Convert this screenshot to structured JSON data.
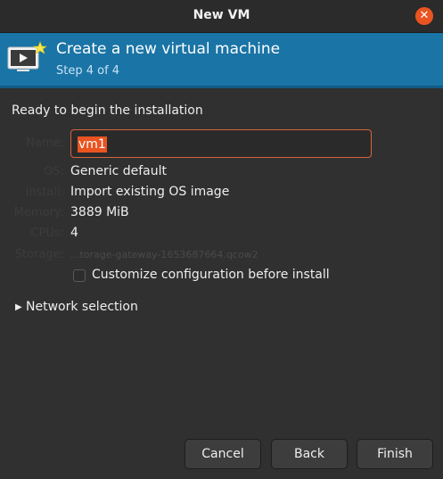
{
  "window": {
    "title": "New VM",
    "close_icon": "close-icon"
  },
  "header": {
    "title": "Create a new virtual machine",
    "step": "Step 4 of 4",
    "icon": "virtual-machine-new-icon",
    "background": "#1a74a6"
  },
  "summary": {
    "heading": "Ready to begin the installation",
    "name_label": "Name:",
    "name_value": "vm1",
    "os_label": "OS:",
    "os_value": "Generic default",
    "install_label": "Install:",
    "install_value": "Import existing OS image",
    "memory_label": "Memory:",
    "memory_value": "3889 MiB",
    "cpus_label": "CPUs:",
    "cpus_value": "4",
    "storage_label": "Storage:",
    "storage_value": "...torage-gateway-1653687664.qcow2"
  },
  "customize": {
    "label": "Customize configuration before install",
    "checked": false
  },
  "network": {
    "label": "Network selection",
    "expanded": false
  },
  "buttons": {
    "cancel": "Cancel",
    "back": "Back",
    "finish": "Finish"
  },
  "colors": {
    "accent": "#e95420",
    "background": "#303030",
    "header": "#1a74a6"
  }
}
